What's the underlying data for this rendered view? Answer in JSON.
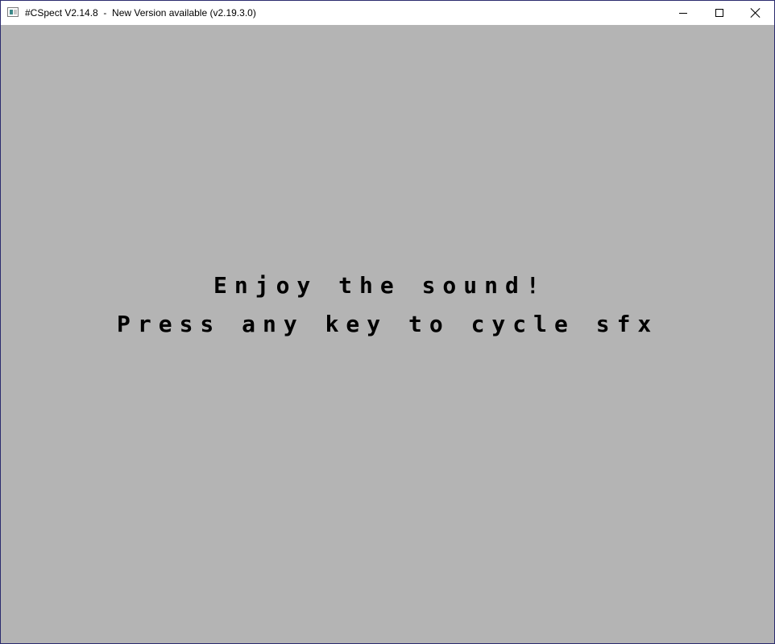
{
  "window": {
    "title": "#CSpect V2.14.8  -  New Version available (v2.19.3.0)",
    "icon": "app-icon"
  },
  "caption_buttons": {
    "minimize": "minimize-icon",
    "maximize": "maximize-icon",
    "close": "close-icon"
  },
  "screen": {
    "background": "#b4b4b4",
    "text_color": "#000000",
    "line1": "Enjoy the sound!",
    "line2": "Press any key to cycle sfx"
  }
}
